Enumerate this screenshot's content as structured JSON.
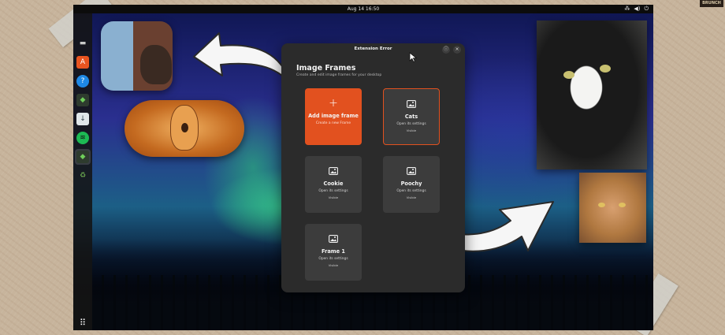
{
  "topbar": {
    "clock": "Aug 14  16:50",
    "tray": [
      "⁂",
      "◀)",
      "⏻"
    ]
  },
  "dock": {
    "apps": [
      {
        "name": "Files",
        "glyph": "▬",
        "color": "#c8c8c8"
      },
      {
        "name": "App Center",
        "glyph": "A",
        "color": "#e95420"
      },
      {
        "name": "Help",
        "glyph": "?",
        "color": "#1e88e5"
      },
      {
        "name": "Extensions",
        "glyph": "◆",
        "color": "#4caf50"
      },
      {
        "name": "Installer",
        "glyph": "↓",
        "color": "#90a4ae"
      },
      {
        "name": "Spotify",
        "glyph": "≋",
        "color": "#1db954"
      },
      {
        "name": "Extension Manager",
        "glyph": "◆",
        "color": "#4caf50"
      },
      {
        "name": "Trash",
        "glyph": "♻",
        "color": "#6aa84f"
      }
    ],
    "show_apps_glyph": "⠿"
  },
  "dialog": {
    "window_title": "Extension Error",
    "info_glyph": "ⓘ",
    "close_glyph": "×",
    "app_title": "Image Frames",
    "app_subtitle": "Create and edit image frames for your desktop",
    "add_card": {
      "glyph": "+",
      "title": "Add image frame",
      "subtitle": "Create a new Frame"
    },
    "frames": [
      {
        "title": "Cats",
        "subtitle": "Open its settings",
        "status": "Visible"
      },
      {
        "title": "Cookie",
        "subtitle": "Open its settings",
        "status": "Visible"
      },
      {
        "title": "Poochy",
        "subtitle": "Open its settings",
        "status": "Visible"
      },
      {
        "title": "Frame 1",
        "subtitle": "Open its settings",
        "status": "Visible"
      }
    ]
  },
  "corner_badge": "BRUNCH",
  "colors": {
    "accent": "#e2511f",
    "card": "#3c3c3c",
    "dialog": "#2b2b2b"
  }
}
